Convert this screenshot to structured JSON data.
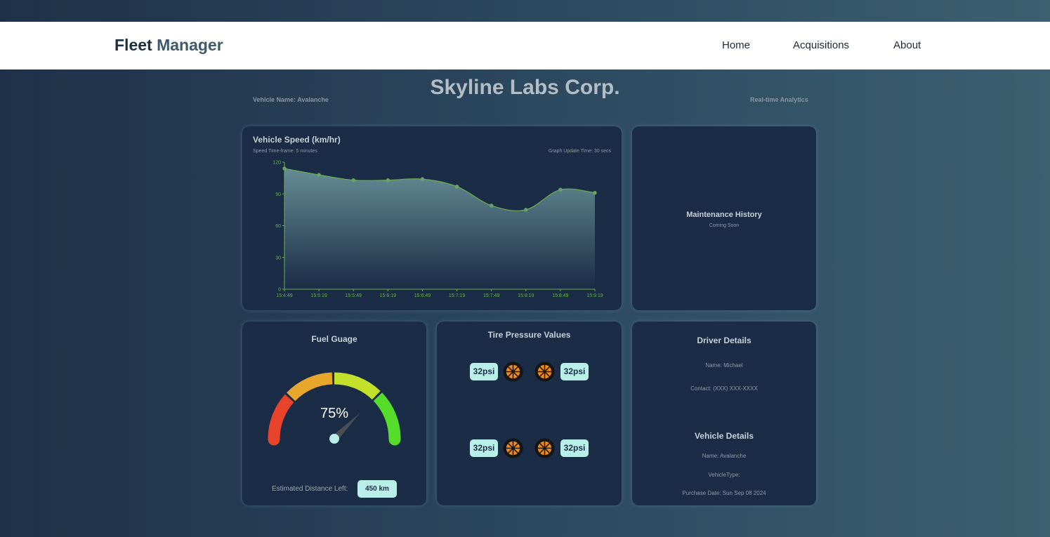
{
  "app": {
    "brand_part1": "Fleet",
    "brand_part2": "Manager",
    "nav": [
      "Home",
      "Acquisitions",
      "About"
    ]
  },
  "header": {
    "company": "Skyline Labs Corp.",
    "vehicle_name": "Vehicle Name: Avalanche",
    "analytics": "Real-time Analytics"
  },
  "speed": {
    "title": "Vehicle Speed (km/hr)",
    "timeframe": "Speed Time-frame: 5 minutes",
    "update": "Graph Update Time: 30 secs"
  },
  "maintenance": {
    "title": "Maintenance History",
    "subtitle": "Coming Soon"
  },
  "fuel": {
    "title": "Fuel Guage",
    "percent_label": "75%",
    "percent": 75,
    "distance_label": "Estimated Distance Left:",
    "distance_value": "450 km"
  },
  "tires": {
    "title": "Tire Pressure Values",
    "front_left": "32psi",
    "front_right": "32psi",
    "rear_left": "32psi",
    "rear_right": "32psi"
  },
  "driver": {
    "title": "Driver Details",
    "name": "Name: Michael",
    "contact": "Contact: (XXX) XXX-XXXX"
  },
  "vehicle": {
    "title": "Vehicle Details",
    "name": "Name: Avalanche",
    "type": "VehicleType:",
    "purchase": "Purchase Date: Sun Sep 08 2024"
  },
  "colors": {
    "accent": "#b8efe9",
    "card": "#1a2c46",
    "chart_line": "#6ab04c",
    "gauge": [
      "#e8432b",
      "#e8a72a",
      "#c3e02a",
      "#55dd2a"
    ]
  },
  "chart_data": {
    "type": "area",
    "x": [
      "15:4:49",
      "15:5:19",
      "15:5:49",
      "15:6:19",
      "15:6:49",
      "15:7:19",
      "15:7:49",
      "15:8:19",
      "15:8:49",
      "15:9:19"
    ],
    "y": [
      114,
      108,
      103,
      103,
      104,
      97,
      79,
      75,
      94,
      91
    ],
    "yticks": [
      0,
      30,
      60,
      90,
      120
    ],
    "ylim": [
      0,
      120
    ],
    "grid": false
  }
}
